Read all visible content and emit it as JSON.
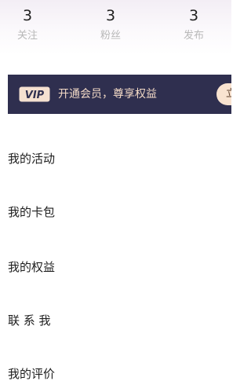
{
  "stats": [
    {
      "count": "3",
      "label": "关注"
    },
    {
      "count": "3",
      "label": "粉丝"
    },
    {
      "count": "3",
      "label": "发布"
    }
  ],
  "vip": {
    "logo_text": "VIP",
    "text": "开通会员，尊享权益",
    "cta_label": "立",
    "background_color": "#2f2f4f",
    "accent_color": "#f2d9c6"
  },
  "menu": [
    {
      "label": "我的活动"
    },
    {
      "label": "我的卡包"
    },
    {
      "label": "我的权益"
    },
    {
      "label": "联 系 我"
    },
    {
      "label": "我的评价"
    }
  ]
}
